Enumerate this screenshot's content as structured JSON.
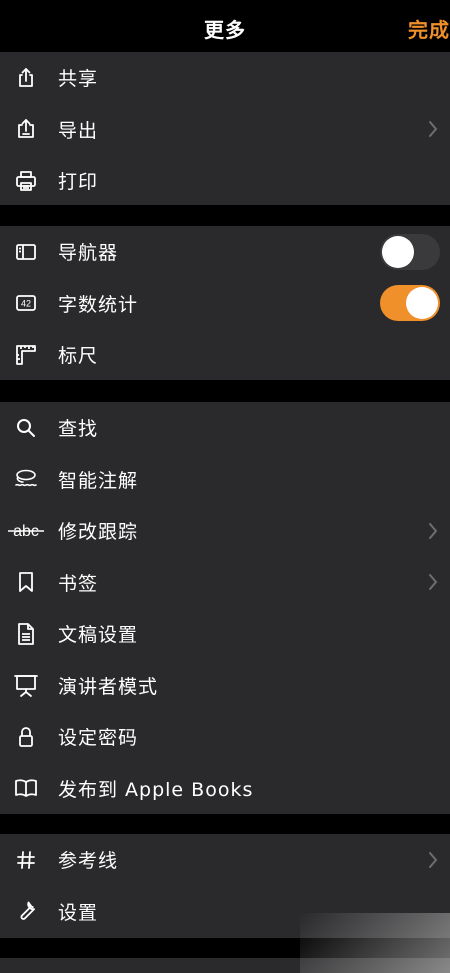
{
  "header": {
    "title": "更多",
    "done_label": "完成"
  },
  "groups": [
    {
      "items": [
        {
          "label": "共享",
          "icon": "share-icon"
        },
        {
          "label": "导出",
          "icon": "export-icon",
          "chevron": true
        },
        {
          "label": "打印",
          "icon": "printer-icon"
        }
      ]
    },
    {
      "items": [
        {
          "label": "导航器",
          "icon": "sidebar-icon",
          "toggle": false
        },
        {
          "label": "字数统计",
          "icon": "word-count-icon",
          "badge": "42",
          "toggle": true
        },
        {
          "label": "标尺",
          "icon": "ruler-icon"
        }
      ]
    },
    {
      "items": [
        {
          "label": "查找",
          "icon": "search-icon"
        },
        {
          "label": "智能注解",
          "icon": "smart-annotation-icon"
        },
        {
          "label": "修改跟踪",
          "icon": "track-changes-icon",
          "icon_text": "abc",
          "chevron": true
        },
        {
          "label": "书签",
          "icon": "bookmark-icon",
          "chevron": true
        },
        {
          "label": "文稿设置",
          "icon": "document-icon"
        },
        {
          "label": "演讲者模式",
          "icon": "presenter-icon"
        },
        {
          "label": "设定密码",
          "icon": "lock-icon"
        },
        {
          "label": "发布到 Apple Books",
          "icon": "book-icon"
        }
      ]
    },
    {
      "items": [
        {
          "label": "参考线",
          "icon": "grid-icon",
          "chevron": true
        },
        {
          "label": "设置",
          "icon": "wrench-icon"
        }
      ]
    }
  ],
  "colors": {
    "accent": "#f0902a",
    "row_bg": "#2a2a2c",
    "page_bg": "#000000"
  }
}
